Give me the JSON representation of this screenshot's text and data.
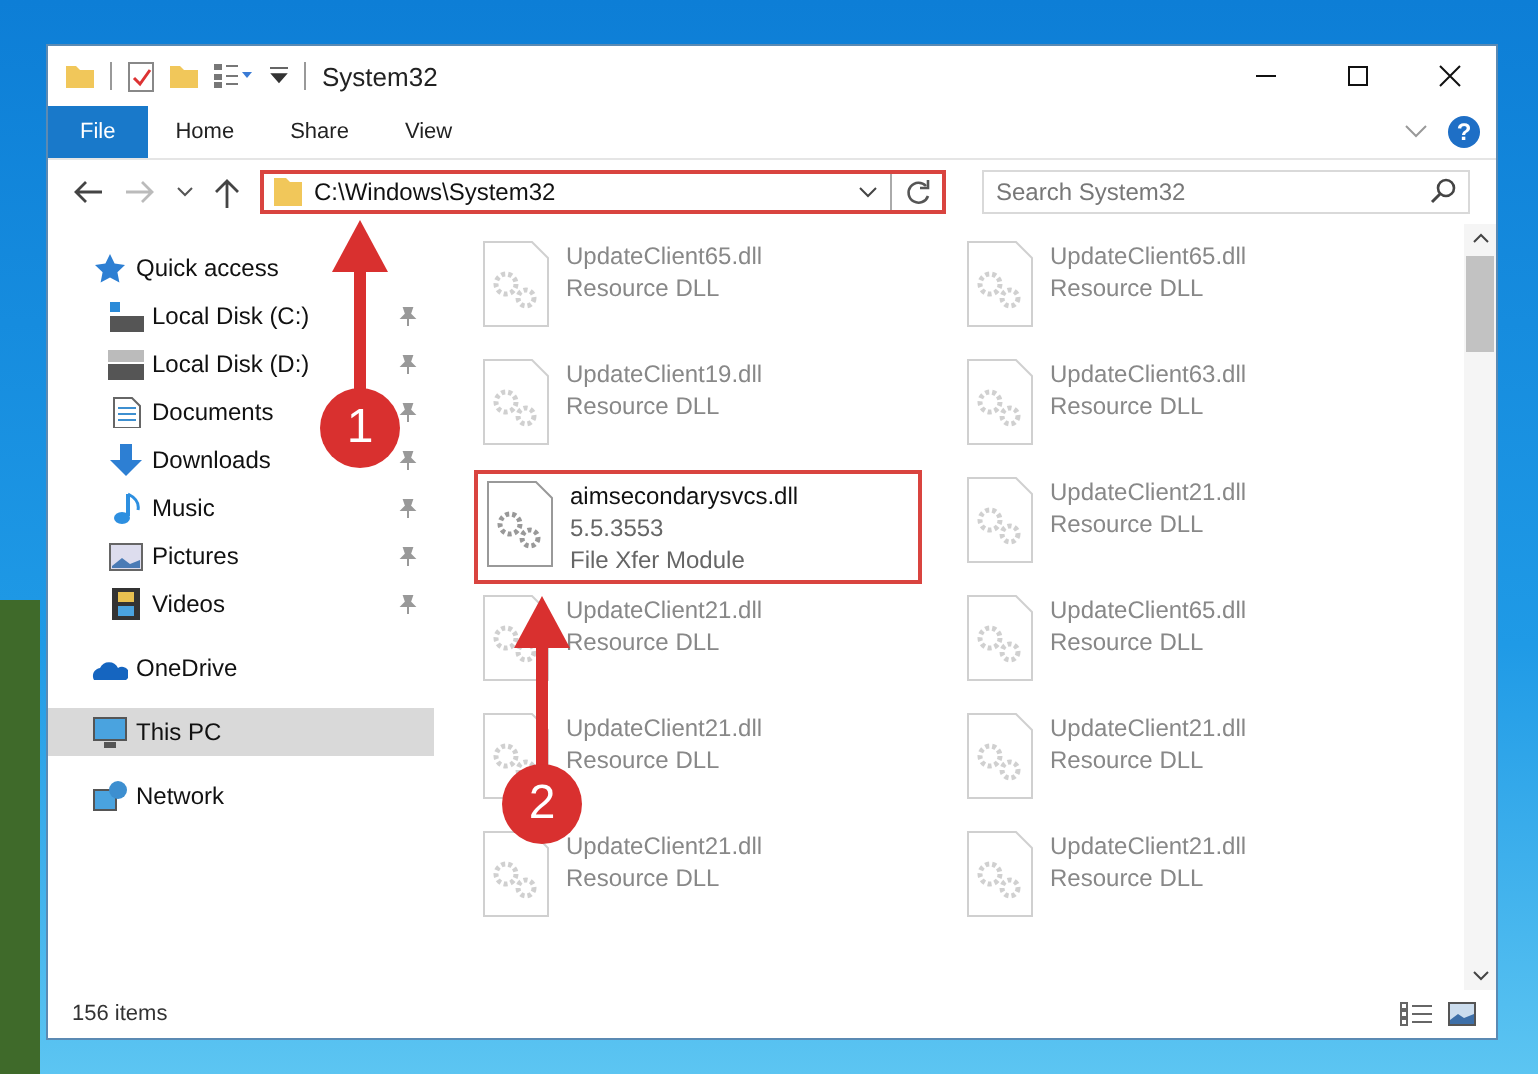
{
  "window": {
    "title": "System32"
  },
  "ribbon_tabs": [
    {
      "label": "File",
      "selected": true
    },
    {
      "label": "Home",
      "selected": false
    },
    {
      "label": "Share",
      "selected": false
    },
    {
      "label": "View",
      "selected": false
    }
  ],
  "help": {
    "label": "?"
  },
  "address_bar": {
    "path": "C:\\Windows\\System32"
  },
  "search": {
    "placeholder": "Search System32"
  },
  "sidebar": {
    "items": [
      {
        "label": "Quick access",
        "kind": "star",
        "pinned": false,
        "selected": false,
        "children": [
          {
            "label": "Local Disk (C:)",
            "kind": "drive-c",
            "pinned": true,
            "selected": false
          },
          {
            "label": "Local Disk (D:)",
            "kind": "drive",
            "pinned": true,
            "selected": false
          },
          {
            "label": "Documents",
            "kind": "documents",
            "pinned": true,
            "selected": false
          },
          {
            "label": "Downloads",
            "kind": "downloads",
            "pinned": true,
            "selected": false
          },
          {
            "label": "Music",
            "kind": "music",
            "pinned": true,
            "selected": false
          },
          {
            "label": "Pictures",
            "kind": "pictures",
            "pinned": true,
            "selected": false
          },
          {
            "label": "Videos",
            "kind": "videos",
            "pinned": true,
            "selected": false
          }
        ]
      },
      {
        "label": "OneDrive",
        "kind": "cloud",
        "pinned": false,
        "selected": false
      },
      {
        "label": "This PC",
        "kind": "pc",
        "pinned": false,
        "selected": true
      },
      {
        "label": "Network",
        "kind": "network",
        "pinned": false,
        "selected": false
      }
    ]
  },
  "files": [
    {
      "name": "UpdateClient65.dll",
      "lines": [
        "Resource DLL"
      ],
      "dimmed": true,
      "highlighted": false
    },
    {
      "name": "UpdateClient65.dll",
      "lines": [
        "Resource DLL"
      ],
      "dimmed": true,
      "highlighted": false
    },
    {
      "name": "UpdateClient19.dll",
      "lines": [
        "Resource DLL"
      ],
      "dimmed": true,
      "highlighted": false
    },
    {
      "name": "UpdateClient63.dll",
      "lines": [
        "Resource DLL"
      ],
      "dimmed": true,
      "highlighted": false
    },
    {
      "name": "aimsecondarysvcs.dll",
      "lines": [
        "5.5.3553",
        "File Xfer Module"
      ],
      "dimmed": false,
      "highlighted": true
    },
    {
      "name": "UpdateClient21.dll",
      "lines": [
        "Resource DLL"
      ],
      "dimmed": true,
      "highlighted": false
    },
    {
      "name": "UpdateClient21.dll",
      "lines": [
        "Resource DLL"
      ],
      "dimmed": true,
      "highlighted": false
    },
    {
      "name": "UpdateClient65.dll",
      "lines": [
        "Resource DLL"
      ],
      "dimmed": true,
      "highlighted": false
    },
    {
      "name": "UpdateClient21.dll",
      "lines": [
        "Resource DLL"
      ],
      "dimmed": true,
      "highlighted": false
    },
    {
      "name": "UpdateClient21.dll",
      "lines": [
        "Resource DLL"
      ],
      "dimmed": true,
      "highlighted": false
    },
    {
      "name": "UpdateClient21.dll",
      "lines": [
        "Resource DLL"
      ],
      "dimmed": true,
      "highlighted": false
    },
    {
      "name": "UpdateClient21.dll",
      "lines": [
        "Resource DLL"
      ],
      "dimmed": true,
      "highlighted": false
    }
  ],
  "annotations": [
    {
      "number": "1"
    },
    {
      "number": "2"
    }
  ],
  "status_bar": {
    "text": "156 items"
  }
}
